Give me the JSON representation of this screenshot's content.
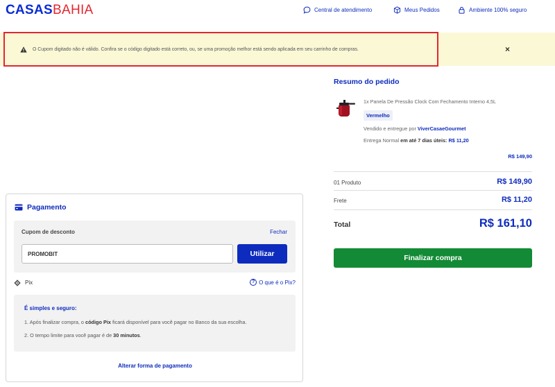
{
  "header": {
    "logo_part1": "CASAS",
    "logo_part2": "BAHIA",
    "links": [
      {
        "label": "Central de atendimento",
        "icon": "chat-icon"
      },
      {
        "label": "Meus Pedidos",
        "icon": "box-icon"
      },
      {
        "label": "Ambiente 100% seguro",
        "icon": "lock-icon"
      }
    ]
  },
  "alert": {
    "icon": "warning-icon",
    "message": "O Cupom digitado não é válido. Confira se o código digitado está correto, ou, se uma promoção melhor está sendo aplicada em seu carrinho de compras.",
    "close": "×"
  },
  "payment": {
    "title": "Pagamento",
    "coupon": {
      "label": "Cupom de desconto",
      "close_label": "Fechar",
      "value": "PROMOBIT",
      "apply_label": "Utilizar"
    },
    "pix": {
      "label": "Pix",
      "help_label": "O que é o Pix?"
    },
    "info": {
      "title": "É simples e seguro:",
      "item1_prefix": "1.  Após finalizar compra, o ",
      "item1_bold": "código Pix",
      "item1_suffix": " ficará disponível para você pagar no Banco da sua escolha.",
      "item2_prefix": "2.  O tempo limite para você pagar é de ",
      "item2_bold": "30 minutos",
      "item2_suffix": "."
    },
    "change_label": "Alterar forma de pagamento"
  },
  "summary": {
    "title": "Resumo do pedido",
    "product": {
      "name": "1x Panela De Pressão Clock Com Fechamento Interno 4,5L",
      "variant": "Vermelho",
      "seller_prefix": "Vendido e entregue por ",
      "seller": "ViverCasaeGourmet",
      "ship_prefix": "Entrega Normal ",
      "ship_bold": "em até 7 dias úteis:",
      "ship_price": "R$ 11,20",
      "price": "R$ 149,90"
    },
    "products_label": "01 Produto",
    "products_value": "R$ 149,90",
    "shipping_label": "Frete",
    "shipping_value": "R$ 11,20",
    "total_label": "Total",
    "total_value": "R$ 161,10",
    "finish_label": "Finalizar compra"
  },
  "colors": {
    "brand_blue": "#0d2bbd",
    "brand_red": "#e3262e",
    "alert_bg": "#fbf8d6",
    "success_green": "#138a35"
  }
}
